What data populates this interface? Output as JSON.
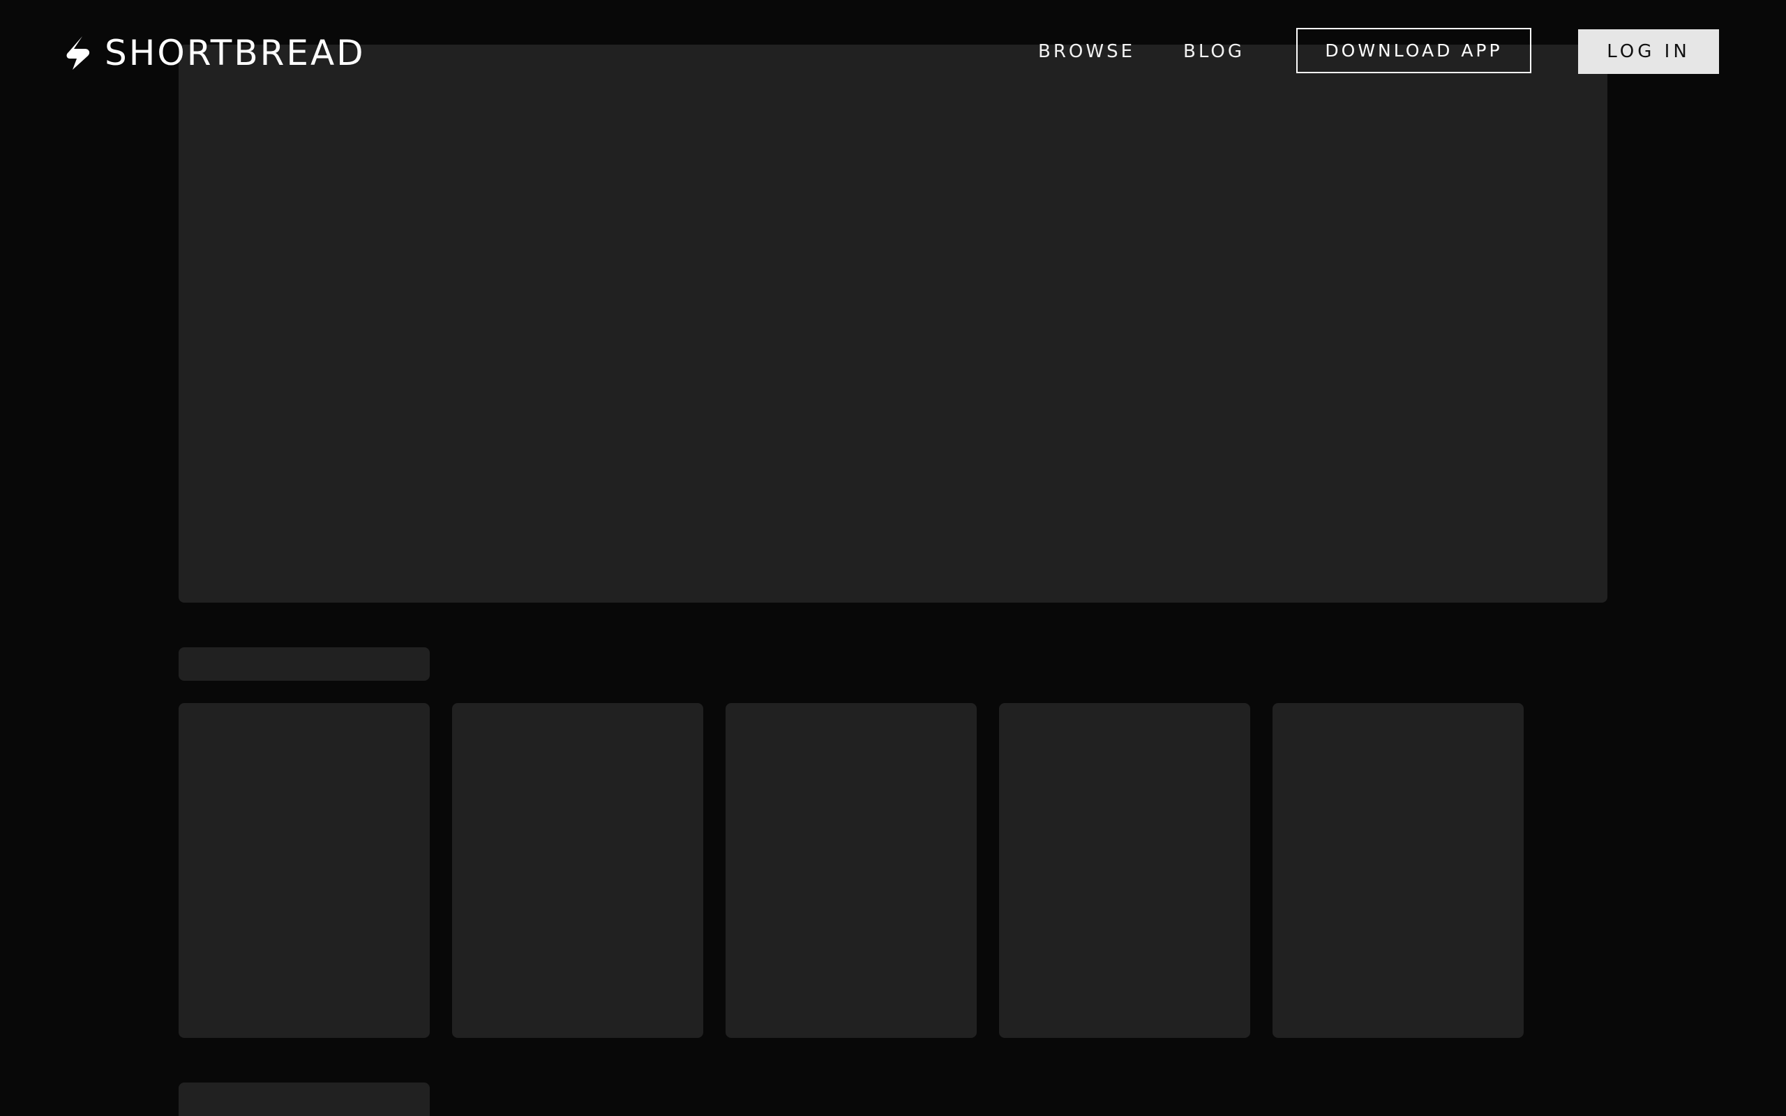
{
  "header": {
    "logo_text": "SHORTBREAD",
    "logo_icon": "lightning-s-icon",
    "nav": {
      "browse_label": "BROWSE",
      "blog_label": "BLOG"
    },
    "download_label": "DOWNLOAD APP",
    "login_label": "LOG IN"
  },
  "colors": {
    "background": "#080808",
    "skeleton": "#212121",
    "text": "#ffffff",
    "login_bg": "#e6e6e6"
  },
  "main": {
    "state": "loading",
    "card_placeholder_count": 5
  }
}
